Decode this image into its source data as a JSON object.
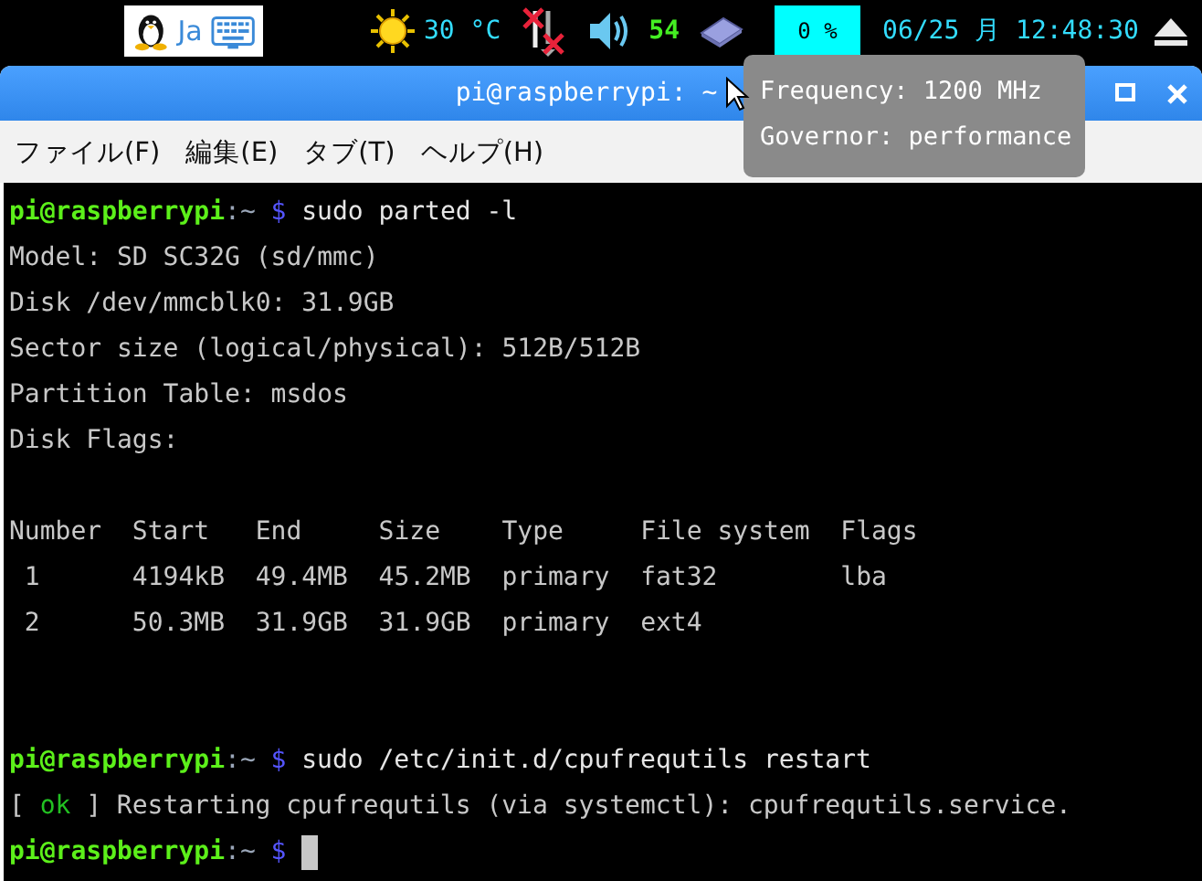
{
  "panel": {
    "input_method": "Ja",
    "temperature": "30 °C",
    "status_number": "54",
    "cpu_usage": "0 %",
    "clock": "06/25 月 12:48:30"
  },
  "tooltip": {
    "lines": [
      "Frequency: 1200 MHz",
      "Governor: performance"
    ]
  },
  "window": {
    "title": "pi@raspberrypi: ~"
  },
  "menu": [
    "ファイル(F)",
    "編集(E)",
    "タブ(T)",
    "ヘルプ(H)"
  ],
  "terminal": {
    "lines": [
      {
        "kind": "prompt",
        "user": "pi@raspberrypi",
        "path": ":~",
        "symbol": "$",
        "command": "sudo parted -l"
      },
      {
        "kind": "output",
        "text": "Model: SD SC32G (sd/mmc)"
      },
      {
        "kind": "output",
        "text": "Disk /dev/mmcblk0: 31.9GB"
      },
      {
        "kind": "output",
        "text": "Sector size (logical/physical): 512B/512B"
      },
      {
        "kind": "output",
        "text": "Partition Table: msdos"
      },
      {
        "kind": "output",
        "text": "Disk Flags:"
      },
      {
        "kind": "blank"
      },
      {
        "kind": "output",
        "text": "Number  Start   End     Size    Type     File system  Flags"
      },
      {
        "kind": "output",
        "text": " 1      4194kB  49.4MB  45.2MB  primary  fat32        lba"
      },
      {
        "kind": "output",
        "text": " 2      50.3MB  31.9GB  31.9GB  primary  ext4"
      },
      {
        "kind": "blank"
      },
      {
        "kind": "blank"
      },
      {
        "kind": "prompt",
        "user": "pi@raspberrypi",
        "path": ":~",
        "symbol": "$",
        "command": "sudo /etc/init.d/cpufrequtils restart"
      },
      {
        "kind": "status",
        "open": "[",
        "status": "ok",
        "close": "]",
        "message": "Restarting cpufrequtils (via systemctl): cpufrequtils.service."
      },
      {
        "kind": "prompt",
        "user": "pi@raspberrypi",
        "path": ":~",
        "symbol": "$",
        "cursor": true
      }
    ]
  }
}
